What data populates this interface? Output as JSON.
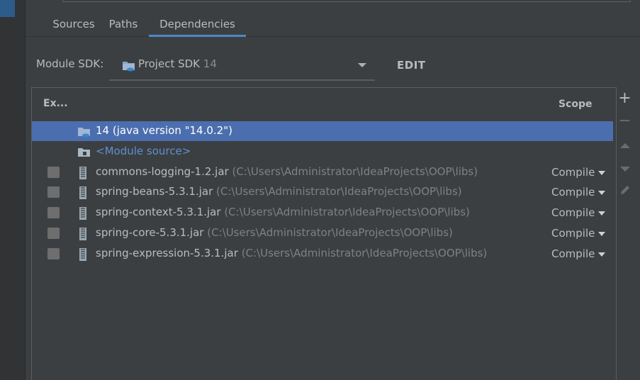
{
  "tabs": [
    {
      "label": "Sources"
    },
    {
      "label": "Paths"
    },
    {
      "label": "Dependencies"
    }
  ],
  "active_tab": "Dependencies",
  "sdk": {
    "label": "Module SDK:",
    "value": "Project SDK",
    "version": "14",
    "edit_label": "EDIT"
  },
  "table": {
    "headers": {
      "export": "Ex...",
      "scope": "Scope"
    },
    "rows": [
      {
        "name": "14 (java version \"14.0.2\")",
        "path": "",
        "scope": "",
        "selected": true,
        "type": "sdk"
      },
      {
        "name": "<Module source>",
        "path": "",
        "scope": "",
        "selected": false,
        "type": "module"
      },
      {
        "name": "commons-logging-1.2.jar",
        "path": "(C:\\Users\\Administrator\\IdeaProjects\\OOP\\libs)",
        "scope": "Compile",
        "selected": false,
        "type": "jar"
      },
      {
        "name": "spring-beans-5.3.1.jar",
        "path": "(C:\\Users\\Administrator\\IdeaProjects\\OOP\\libs)",
        "scope": "Compile",
        "selected": false,
        "type": "jar"
      },
      {
        "name": "spring-context-5.3.1.jar",
        "path": "(C:\\Users\\Administrator\\IdeaProjects\\OOP\\libs)",
        "scope": "Compile",
        "selected": false,
        "type": "jar"
      },
      {
        "name": "spring-core-5.3.1.jar",
        "path": "(C:\\Users\\Administrator\\IdeaProjects\\OOP\\libs)",
        "scope": "Compile",
        "selected": false,
        "type": "jar"
      },
      {
        "name": "spring-expression-5.3.1.jar",
        "path": "(C:\\Users\\Administrator\\IdeaProjects\\OOP\\libs)",
        "scope": "Compile",
        "selected": false,
        "type": "jar"
      }
    ]
  },
  "toolbar": {
    "add": "+",
    "remove": "−",
    "icons": [
      "add-icon",
      "remove-icon",
      "move-up-icon",
      "move-down-icon",
      "edit-pencil-icon"
    ]
  },
  "colors": {
    "background": "#3c3f41",
    "selection": "#4b6eaf",
    "accent": "#4a88c7",
    "module_source": "#5c8fd6"
  }
}
